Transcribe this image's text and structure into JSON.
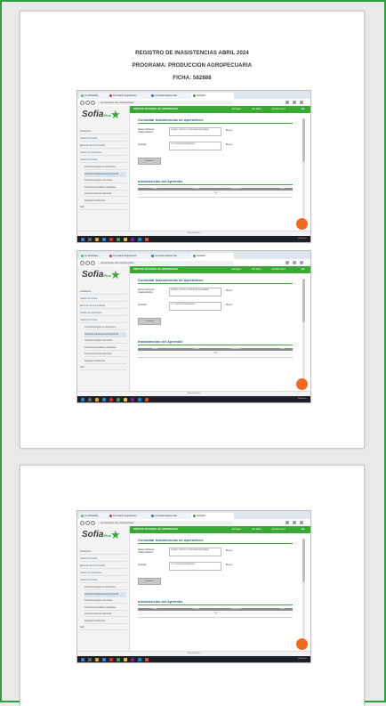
{
  "document": {
    "heading": {
      "line1": "REGISTRO DE INASISTENCIAS ABRIL 2024",
      "line2": "PROGRAMA: PRODUCCION AGROPECUARIA",
      "line3": "FICHA: 582888"
    }
  },
  "screenshot": {
    "browser_tabs": [
      {
        "label": "(1) WhatsApp",
        "color": "#25d366"
      },
      {
        "label": "Formulario Seguimiento",
        "color": "#d9302c"
      },
      {
        "label": "Consulta Inasistencias",
        "color": "#2c6fd9"
      },
      {
        "label": "Sofiaplus",
        "color": "#3aa935"
      }
    ],
    "url": "senasofiaplus.edu.co/sofia-public/",
    "logo": {
      "text": "Sofia",
      "suffix": "Plus"
    },
    "sidebar_items": [
      {
        "label": "Indicadores",
        "style": "plain"
      },
      {
        "label": "Gestión Curricular",
        "style": "main"
      },
      {
        "label": "Ejecución de la Formación",
        "style": "main"
      },
      {
        "label": "Gestión de Aprendices",
        "style": "main"
      },
      {
        "label": "Gestión de Títulos",
        "style": "main"
      },
      {
        "label": "Consultar Registro de Asistencia",
        "style": "sub"
      },
      {
        "label": "Consultar Inasistencias de Aprendiz",
        "style": "sub hl"
      },
      {
        "label": "Consultar Registro por Fichas",
        "style": "sub"
      },
      {
        "label": "Consultar Novedades reportadas",
        "style": "sub"
      },
      {
        "label": "Consultar Novedad Aprendiz",
        "style": "sub"
      },
      {
        "label": "Registrar Inasistencia",
        "style": "sub"
      },
      {
        "label": "Salir",
        "style": "main"
      }
    ],
    "topbar": {
      "brand": "SERVICIO NACIONAL DE APRENDIZAJE",
      "items": [
        "Mensajes",
        "Mis Datos",
        "Cambiar Clave",
        "Salir"
      ]
    },
    "form": {
      "title": "Consultar Inasistencias de Aprendices",
      "field1_label": "Número Ficha de Caracterización:",
      "field1_value": "582888 - PRODUCCION AGROPECUARIA",
      "field2_label": "Aprendiz:",
      "field2_value": "CC 1234567890 APRENDIZ",
      "lookup_label": "Buscar",
      "button_label": "Consultar",
      "section_title": "Inasistencias del Aprendiz",
      "table_headers": [
        "Fecha",
        "Jornada",
        "Competencia",
        "Horas"
      ],
      "link_label": "Ver"
    },
    "statusbar": "Sena Sofia Plus",
    "clock": "10:45 a.m."
  }
}
